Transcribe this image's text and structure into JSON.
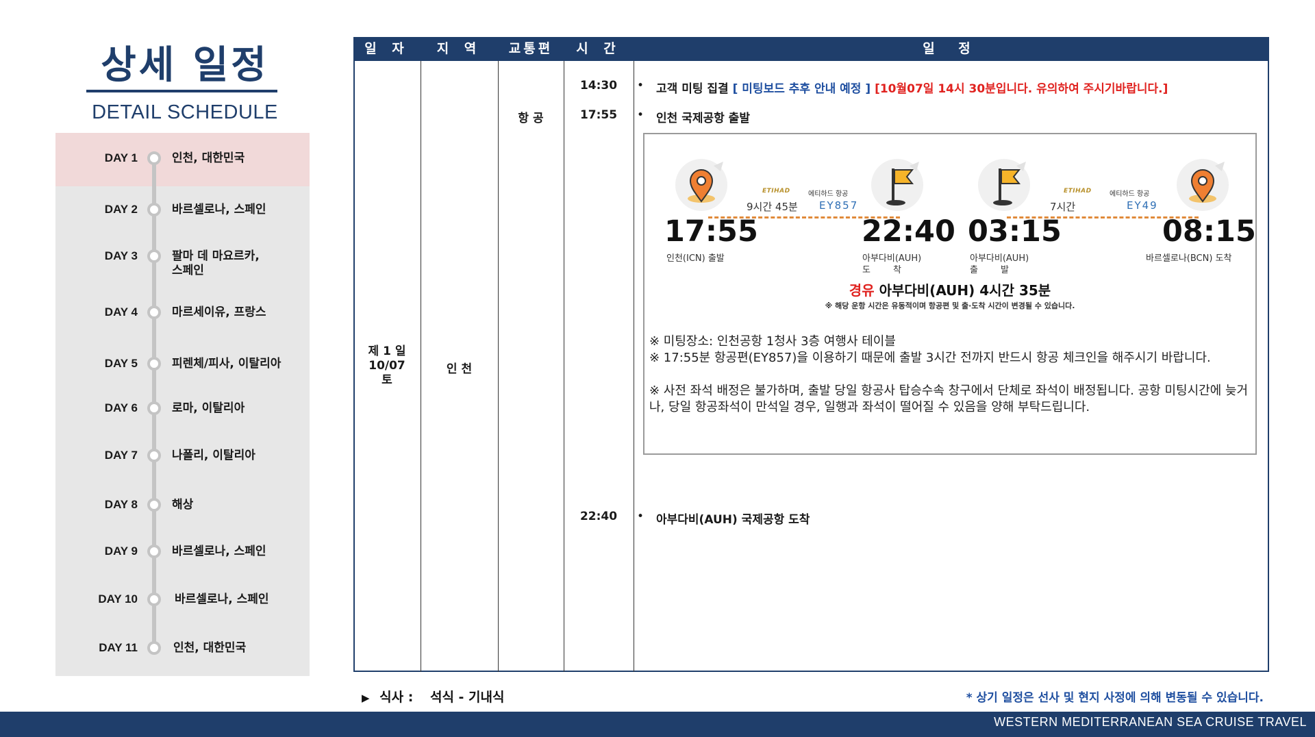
{
  "header": {
    "title_ko": "상세 일정",
    "title_en": "DETAIL SCHEDULE"
  },
  "days": [
    {
      "label": "DAY 1",
      "place": "인천, 대한민국",
      "active": true
    },
    {
      "label": "DAY 2",
      "place": "바르셀로나, 스페인"
    },
    {
      "label": "DAY 3",
      "place": "팔마 데 마요르카,\n스페인"
    },
    {
      "label": "DAY 4",
      "place": "마르세이유, 프랑스"
    },
    {
      "label": "DAY 5",
      "place": "피렌체/피사, 이탈리아"
    },
    {
      "label": "DAY 6",
      "place": "로마, 이탈리아"
    },
    {
      "label": "DAY 7",
      "place": "나폴리, 이탈리아"
    },
    {
      "label": "DAY 8",
      "place": "해상"
    },
    {
      "label": "DAY 9",
      "place": "바르셀로나, 스페인"
    },
    {
      "label": "DAY 10",
      "place": "바르셀로나, 스페인"
    },
    {
      "label": "DAY 11",
      "place": "인천, 대한민국"
    }
  ],
  "table": {
    "headers": [
      "일 자",
      "지 역",
      "교통편",
      "시 간",
      "일 정"
    ],
    "day_cell": {
      "line1": "제 1 일",
      "line2": "10/07",
      "line3": "토"
    },
    "region": "인 천",
    "transport": "항 공",
    "rows": [
      {
        "time": "14:30",
        "bullet": "•",
        "text": "고객 미팅 집결",
        "blue_text": "[ 미팅보드 추후 안내 예정 ]",
        "red_text": "[10월07일 14시 30분입니다. 유의하여 주시기바랍니다.]"
      },
      {
        "time": "17:55",
        "bullet": "•",
        "text": "인천 국제공항 출발"
      },
      {
        "time": "22:40",
        "bullet": "•",
        "text": "아부다비(AUH) 국제공항 도착"
      }
    ]
  },
  "flight": {
    "leg1": {
      "duration": "9시간 45분",
      "airline": "에티하드 항공",
      "logo": "ETIHAD",
      "flight_no": "EY857",
      "dep_time": "17:55",
      "dep_label": "인천(ICN) 출발",
      "arr_time": "22:40",
      "arr_label_1": "아부다비(AUH)",
      "arr_label_2": "도        착"
    },
    "leg2": {
      "duration": "7시간",
      "airline": "에티하드 항공",
      "logo": "ETIHAD",
      "flight_no": "EY49",
      "dep_time": "03:15",
      "dep_label_1": "아부다비(AUH)",
      "dep_label_2": "출        발",
      "arr_time": "08:15",
      "arr_label": "바르셀로나(BCN) 도착"
    },
    "transit_word": "경유",
    "transit_text": "아부다비(AUH) 4시간 35분",
    "transit_note": "※ 해당 운항 시간은 유동적이며 항공편 및 출·도착 시간이 변경될 수 있습니다.",
    "notes": [
      "※ 미팅장소: 인천공항 1청사 3층 여행사 테이블",
      "※ 17:55분 항공편(EY857)을 이용하기 때문에 출발 3시간 전까지 반드시 항공 체크인을 해주시기 바랍니다.",
      "※ 사전 좌석 배정은 불가하며, 출발 당일 항공사 탑승수속 창구에서 단체로 좌석이 배정됩니다. 공항 미팅시간에 늦거나, 당일 항공좌석이 만석일 경우, 일행과 좌석이 떨어질 수 있음을 양해 부탁드립니다."
    ],
    "icons": [
      "map-pin-icon",
      "flag-icon",
      "flag-icon",
      "map-pin-icon"
    ]
  },
  "footer": {
    "meal_label": "식사 :",
    "meal_value": "석식 - 기내식",
    "note": "* 상기 일정은 선사 및 현지 사정에 의해 변동될 수 있습니다.",
    "brand": "WESTERN MEDITERRANEAN SEA CRUISE TRAVEL"
  },
  "colors": {
    "navy": "#1f3e6b",
    "accent_red": "#e0221f",
    "accent_blue": "#1f4fa0",
    "orange": "#e08a3a",
    "active_day_bg": "#f1d9d9",
    "panel_bg": "#e7e7e7"
  }
}
